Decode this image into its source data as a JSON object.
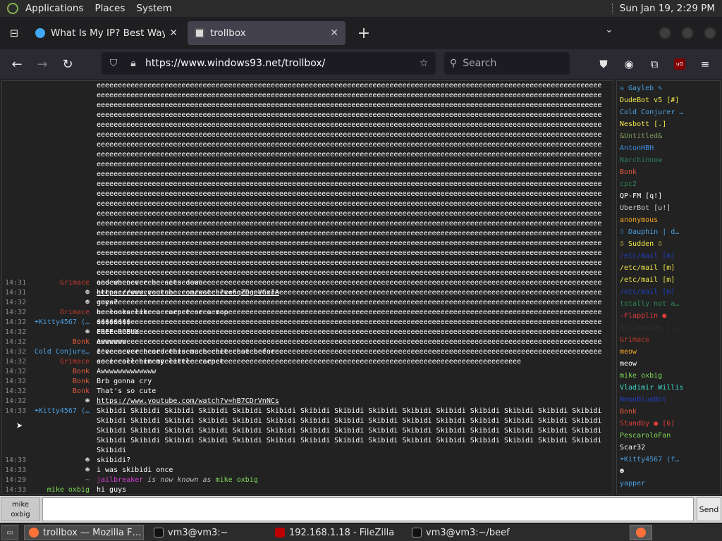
{
  "panel": {
    "menus": [
      "Applications",
      "Places",
      "System"
    ],
    "clock": "Sun Jan 19,  2:29 PM"
  },
  "browser": {
    "tabs": [
      {
        "title": "What Is My IP? Best Way To",
        "active": false
      },
      {
        "title": "trollbox",
        "active": true
      }
    ],
    "url": "https://www.windows93.net/trollbox/",
    "search_placeholder": "Search",
    "icons": [
      "back-icon",
      "forward-icon",
      "reload-icon",
      "shield-icon",
      "lock-icon",
      "bookmark-star-icon",
      "search-icon",
      "pocket-icon",
      "account-icon",
      "extensions-icon",
      "ublock-icon",
      "menu-icon"
    ]
  },
  "trollbox": {
    "spam_lines": [
      "eeeeeeeeeeeeeeeeeeeeeeeeeeeeeeeeeeeeeeeeeeeeeeeeeeeeeeeeeeeeeeeeeeeeeeeeeeeeeeeeeeeeeeeeeeeeeeeeeeeeeeeeeeeeeeeeeeeeeee",
      "eeeeeeeeeeeeeeeeeeeeeeeeeeeeeeeeeeeeeeeeeeeeeeeeeeeeeeeeeeeeeeeeeeeeeeeeeeeeeeeeeeeeeeeeeeeeeeeeeeeeeeeeeeeeeeeeeeeeeee",
      "eeeeeeeeeeeeeeeeeeeeeeeeeeeeeeeeeeeeeeeeeeeeeeeeeeeeeeeeeeeeeeeeeeeeeeeeeeeeeeeeeeeeeeeeeeeeeeeeeeeeeeeeeeeeeeeeeeeeeee",
      "eeeeeeeeeeeeeeeeeeeeeeeeeeeeeeeeeeeeeeeeeeeeeeeeeeeeeeeeeeeeeeeeeeeeeeeeeeeeeeeeeeeeeeeeeeeeeeeeeeeeeeeeeeeeeeeeeeeeeee",
      "eeeeeeeeeeeeeeeeeeeeeeeeeeeeeeeeeeeeeeeeeeeeeeeeeeeeeeeeeeeeeeeeeeeeeeeeeeeeeeeeeeeeeeeeeeeeeeeeeeeeeeeeeeeeeeeeeeeeeee",
      "eeeeeeeeeeeeeeeeeeeeeeeeeeeeeeeeeeeeeeeeeeeeeeeeeeeeeeeeeeeeeeeeeeeeeeeeeeeeeeeeeeeeeeeeeeeeeeeeeeeeeeeeeeeeeeeeeeeeeee",
      "eeeeeeeeeeeeeeeeeeeeeeeeeeeeeeeeeeeeeeeeeeeeeeeeeeeeeeeeeeeeeeeeeeeeeeeeeeeeeeeeeeeeeeeeeeeeeeeeeeeeeeeeeeeeeeeeeeeeeee",
      "eeeeeeeeeeeeeeeeeeeeeeeeeeeeeeeeeeeeeeeeeeeeeeeeeeeeeeeeeeeeeeeeeeeeeeeeeeeeeeeeeeeeeeeeeeeeeeeeeeeeeeeeeeeeeeeeeeeeeee",
      "eeeeeeeeeeeeeeeeeeeeeeeeeeeeeeeeeeeeeeeeeeeeeeeeeeeeeeeeeeeeeeeeeeeeeeeeeeeeeeeeeeeeeeeeeeeeeeeeeeeeeeeeeeeeeeeeeeeeeee",
      "eeeeeeeeeeeeeeeeeeeeeeeeeeeeeeeeeeeeeeeeeeeeeeeeeeeeeeeeeeeeeeeeeeeeeeeeeeeeeeeeeeeeeeeeeeeeeeeeeeeeeeeeeeeeeeeeeeeeeee",
      "eeeeeeeeeeeeeeeeeeeeeeeeeeeeeeeeeeeeeeeeeeeeeeeeeeeeeeeeeeeeeeeeeeeeeeeeeeeeeeeeeeeeeeeeeeeeeeeeeeeeeeeeeeeeeeeeeeeeeee",
      "eeeeeeeeeeeeeeeeeeeeeeeeeeeeeeeeeeeeeeeeeeeeeeeeeeeeeeeeeeeeeeeeeeeeeeeeeeeeeeeeeeeeeeeeeeeeeeeeeeeeeeeeeeeeeeeeeeeeeee",
      "eeeeeeeeeeeeeeeeeeeeeeeeeeeeeeeeeeeeeeeeeeeeeeeeeeeeeeeeeeeeeeeeeeeeeeeeeeeeeeeeeeeeeeeeeeeeeeeeeeeeeeeeeeeeeeeeeeeeeee",
      "eeeeeeeeeeeeeeeeeeeeeeeeeeeeeeeeeeeeeeeeeeeeeeeeeeeeeeeeeeeeeeeeeeeeeeeeeeeeeeeeeeeeeeeeeeeeeeeeeeeeeeeeeeeeeeeeeeeeeee",
      "eeeeeeeeeeeeeeeeeeeeeeeeeeeeeeeeeeeeeeeeeeeeeeeeeeeeeeeeeeeeeeeeeeeeeeeeeeeeeeeeeeeeeeeeeeeeeeeeeeeeeeeeeeeeeeeeeeeeeee",
      "eeeeeeeeeeeeeeeeeeeeeeeeeeeeeeeeeeeeeeeeeeeeeeeeeeeeeeeeeeeeeeeeeeeeeeeeeeeeeeeeeeeeeeeeeeeeeeeeeeeeeeeeeeeeeeeeeeeeeee",
      "eeeeeeeeeeeeeeeeeeeeeeeeeeeeeeeeeeeeeeeeeeeeeeeeeeeeeeeeeeeeeeeeeeeeeeeeeeeeeeeeeeeeeeeeeeeeeeeeeeeeeeeeeeeeeeeeeeeeeee",
      "eeeeeeeeeeeeeeeeeeeeeeeeeeeeeeeeeeeeeeeeeeeeeeeeeeeeeeeeeeeeeeeeeeeeeeeeeeeeeeeeeeeeeeeeeeeeeeeeeeeeeeeeeeeeeeeeeeeeeee",
      "eeeeeeeeeeeeeeeeeeeeeeeeeeeeeeeeeeeeeeeeeeeeeeeeeeeeeeeeeeeeeeeeeeeeeeeeeeeeeeeeeeeeeeeeeeeeeeeeeeeeeeeeeeeeeeeeeeeeeee",
      "eeeeeeeeeeeeeeeeeeeeeeeeeeeeeeeeeeeeeeeeeeeeeeeeeeeeeeeeeeeeeeeeeeeeeeeeeeeeeeeeeeeeeeeeeeeeeeeeeeeeeeeeeeeeeeeeeeeeeee",
      "eeeeeeeeeeeeeeeeeeeeeeeeeeeeeeeeeeeeeeeeeeeeeeeeeeeeeeeeeeeeeeeeeeeeeeeeeeeeeeeeeeeeeeeeeeeeeeeeeeeeeeeeeeeeeeeeeeeeeee",
      "eeeeeeeeeeeeeeeeeeeeeeeeeeeeeeeeeeeeeeeeeeeeeeeeeeeeeeeeeeeeeeeeeeeeeeeeeeeeeeeeeeeeeeeeeeeeeeeeeeeeeeeeeeeeeeeeeeeeeee",
      "eeeeeeeeeeeeeeeeeeeeeeeeeeeeeeeeeeeeeeeeeeeeeeeeeeeeeeeeeeeeeeeeeeeeeeeeeeeeeeeeeeeeeeeeeeeeeeeeeeeeeeeeeeeeeeeeeeeeeee",
      "eeeeeeeeeeeeeeeeeeeeeeeeeeeeeeeeeeeeeeeeeeeeeeeeeeeeeeeeeeeeeeeeeeeeeeeeeeeeeeeeeeeeeeeeeeeeeeeeeeeeeeeeeeeeeeeeeeeeeee",
      "eeeeeeeeeeeeeeeeeeeeeeeeeeeeeeeeeeeeeeeeeeeeeeeeeeeeeeeeeeeeeeeeeeeeeeeeeeeeeeeeeeeeeeeeeeeeeeeeeeeeeeeeeeeeeeeeeeeeeee",
      "eeeeeeeeeeeeeeeeeeeeeeeeeeeeeeeeeeeeeeeeeeeeeeeeeeeeeeeeeeeeeeeeeeeeeeeeeeeeeeeeeeeeeeeeeeeeeeeeeeeeeeeeeeeeeeeeeeeeeee",
      "eeeeeeeeeeeeeeeeeeeeeeeeeeeeeeeeeeeeeeeeeeeeeeeeeeeeeeeeeeeeeeeeeeeeeeeeeeeeeeeeeeeeeeeeeeeeeeeeeeeeeeeeeeeeeeeeeeeeeee",
      "eeeeeeeeeeeeeeeeeeeeeeeeeeeeeeeeeeeeeeeeeeeeeeeeeeeeeeeeeeeeeeeeeeeeeeeeeeeeeeeeeeeeeeeeeeeeeeeeeeeeeeeeeeeeeeeeeeeeeee",
      "eeeeeeeeeeeeeeeeeeeeeeeeeeeeeeeeeeeeeeeeeeeeeeeeeeeeeeeeeeeeeeeeeeeeeeeeeeeeeeeeeeeeeeeeeeeeeeeeeeee"
    ],
    "messages": [
      {
        "time": "14:31",
        "nick": "Grimace",
        "nick_color": "#c0392b",
        "text": "and whenever he sits down"
      },
      {
        "time": "14:31",
        "nick": "☻",
        "nick_color": "#dddddd",
        "text": "https://www.youtube.com/watch?v=6qZDgnVGxIA",
        "link": true
      },
      {
        "time": "14:32",
        "nick": "☻",
        "nick_color": "#dddddd",
        "text": "guys?"
      },
      {
        "time": "14:32",
        "nick": "Grimace",
        "nick_color": "#c0392b",
        "text": "he looks like a carpet or a mop"
      },
      {
        "time": "14:32",
        "nick": "☂Kitty4567 (…",
        "nick_color": "#4a9fe0",
        "text": " $$$$$$$$"
      },
      {
        "time": "14:32",
        "nick": "☻",
        "nick_color": "#dddddd",
        "text": "FREE ROBUX"
      },
      {
        "time": "14:32",
        "nick": "Bonk",
        "nick_color": "#e0593c",
        "text": "Awwwwww"
      },
      {
        "time": "14:32",
        "nick": "Cold Conjure…",
        "nick_color": "#4a9fe0",
        "text": "I've never heard this much chit-chat before."
      },
      {
        "time": "14:32",
        "nick": "Grimace",
        "nick_color": "#c0392b",
        "text": "so i call him my little carpet"
      },
      {
        "time": "14:32",
        "nick": "Bonk",
        "nick_color": "#e0593c",
        "text": "Awwwwwwwwwwwww"
      },
      {
        "time": "14:32",
        "nick": "Bonk",
        "nick_color": "#e0593c",
        "text": "Brb gonna cry"
      },
      {
        "time": "14:32",
        "nick": "Bonk",
        "nick_color": "#e0593c",
        "text": "That's so cute"
      },
      {
        "time": "14:32",
        "nick": "☻",
        "nick_color": "#dddddd",
        "text": "https://www.youtube.com/watch?v=hB7CDrVnNCs",
        "link": true
      },
      {
        "time": "14:33",
        "nick": "☂Kitty4567 (…",
        "nick_color": "#4a9fe0",
        "text": "Skibidi Skibidi Skibidi Skibidi Skibidi Skibidi Skibidi Skibidi Skibidi Skibidi Skibidi Skibidi Skibidi Skibidi Skibidi Skibidi Skibidi Skibidi Skibidi Skibidi Skibidi Skibidi Skibidi Skibidi Skibidi Skibidi Skibidi Skibidi Skibidi Skibidi Skibidi Skibidi Skibidi Skibidi Skibidi Skibidi Skibidi Skibidi Skibidi Skibidi Skibidi Skibidi Skibidi Skibidi Skibidi Skibidi Skibidi Skibidi Skibidi Skibidi Skibidi Skibidi Skibidi Skibidi Skibidi Skibidi Skibidi Skibidi Skibidi Skibidi Skibidi",
        "wrap": true
      },
      {
        "time": "14:33",
        "nick": "☻",
        "nick_color": "#dddddd",
        "text": "skibidi?"
      },
      {
        "time": "14:33",
        "nick": "☻",
        "nick_color": "#dddddd",
        "text": "i was skibidi once"
      },
      {
        "time": "14:29",
        "nick": "~",
        "nick_color": "#888888",
        "text_parts": [
          {
            "t": "jailbreaker",
            "c": "#d43fd4"
          },
          {
            "t": " is now known as ",
            "c": "#bbbbbb",
            "italic": true
          },
          {
            "t": "mike oxbig",
            "c": "#7ed957"
          }
        ]
      },
      {
        "time": "14:33",
        "nick": "mike oxbig",
        "nick_color": "#7ed957",
        "text": "hi guys"
      }
    ],
    "users": [
      {
        "name": "☠ Gayleb ✎",
        "color": "#4a9fe0"
      },
      {
        "name": "DudeBot v5 [#]",
        "color": "#f5e94b"
      },
      {
        "name": "Cold Conjurer …",
        "color": "#4a9fe0"
      },
      {
        "name": "Nesbott [.]",
        "color": "#f5e94b"
      },
      {
        "name": "&Untitled&",
        "color": "#7e9b5c"
      },
      {
        "name": "AntonHBH",
        "color": "#3a8fe0"
      },
      {
        "name": "Narchinnow",
        "color": "#2e7d6a"
      },
      {
        "name": "Bonk",
        "color": "#e0593c"
      },
      {
        "name": "cpc2",
        "color": "#2e8b57"
      },
      {
        "name": "QP-FM [q!]",
        "color": "#ffffff"
      },
      {
        "name": "UberBot [u!]",
        "color": "#cccccc"
      },
      {
        "name": "anonymous",
        "color": "#f5a623"
      },
      {
        "name": "☃ Dauphin | d…",
        "color": "#4a9fe0"
      },
      {
        "name": "☃ Sudden ☃",
        "color": "#f5e94b"
      },
      {
        "name": "/etc/mail [m]",
        "color": "#1f3fbf"
      },
      {
        "name": "/etc/mail [m]",
        "color": "#f5e94b"
      },
      {
        "name": "/etc/mail [m]",
        "color": "#f5e94b"
      },
      {
        "name": "/etc/mail [m]",
        "color": "#1f3fbf"
      },
      {
        "name": "totally not a…",
        "color": "#2e8b57"
      },
      {
        "name": "-Flapplin ●",
        "color": "#e03c3c"
      },
      {
        "name": "Actinatter | …",
        "color": "#333333"
      },
      {
        "name": "Grimace",
        "color": "#c0392b"
      },
      {
        "name": "meow",
        "color": "#f5a623"
      },
      {
        "name": "meow",
        "color": "#ffffff"
      },
      {
        "name": "mike oxbig",
        "color": "#7ed957"
      },
      {
        "name": "Vladimir Willis",
        "color": "#3dd6c8"
      },
      {
        "name": "NeonBlueBot",
        "color": "#1f3fbf"
      },
      {
        "name": "Bonk",
        "color": "#e0593c"
      },
      {
        "name": "Standby ● [6]",
        "color": "#e03c3c"
      },
      {
        "name": "PescaroloFan",
        "color": "#7ed957"
      },
      {
        "name": "Scar32",
        "color": "#ffffff"
      },
      {
        "name": "☂Kitty4567 (f…",
        "color": "#4a9fe0"
      },
      {
        "name": "☻",
        "color": "#ffffff"
      },
      {
        "name": "yapper",
        "color": "#4a9fe0"
      }
    ],
    "nick_button_line1": "mike",
    "nick_button_line2": "oxbig",
    "message_input_value": "",
    "send_label": "Send"
  },
  "taskbar": {
    "show_desktop_label": "▭",
    "tasks": [
      {
        "label": "trollbox — Mozilla F…",
        "icon": "firefox-icon",
        "active": true
      },
      {
        "label": "vm3@vm3:~",
        "icon": "terminal-icon",
        "active": false
      },
      {
        "label": "192.168.1.18 - FileZilla",
        "icon": "filezilla-icon",
        "active": false
      },
      {
        "label": "vm3@vm3:~/beef",
        "icon": "terminal-icon",
        "active": false
      }
    ]
  }
}
